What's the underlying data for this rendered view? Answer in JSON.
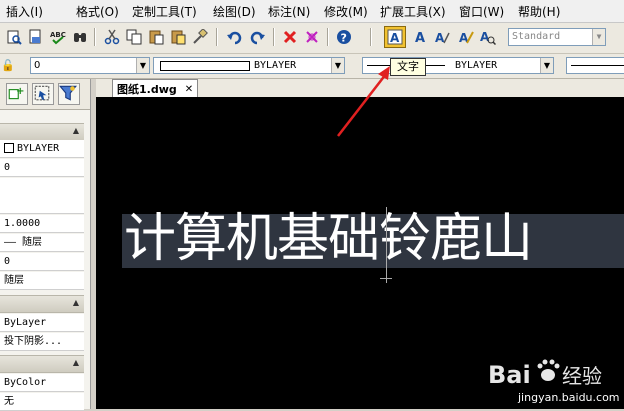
{
  "menu": {
    "items": [
      "插入(I)",
      "格式(O)",
      "定制工具(T)",
      "绘图(D)",
      "标注(N)",
      "修改(M)",
      "扩展工具(X)",
      "窗口(W)",
      "帮助(H)"
    ]
  },
  "toolbar": {
    "text_style_value": "Standard",
    "tooltip": "文字",
    "layer_value": "0",
    "color_value": "BYLAYER",
    "linetype_value": "BYLAYER"
  },
  "drawing": {
    "tab_title": "图纸1.dwg",
    "tab_close": "✕",
    "text": "计算机基础铃鹿山"
  },
  "properties": {
    "rows": [
      "BYLAYER",
      "0",
      "",
      "1.0000",
      "—— 随层",
      "0",
      "随层"
    ],
    "section2_rows": [
      "ByLayer",
      "投下阴影..."
    ],
    "section3_rows": [
      "ByColor",
      "无"
    ]
  },
  "watermark": {
    "brand_prefix": "Bai",
    "brand_suffix": "经验",
    "url": "jingyan.baidu.com"
  },
  "colors": {
    "canvas": "#000000",
    "arrow": "#e02020",
    "highlight": "#f2c230"
  }
}
